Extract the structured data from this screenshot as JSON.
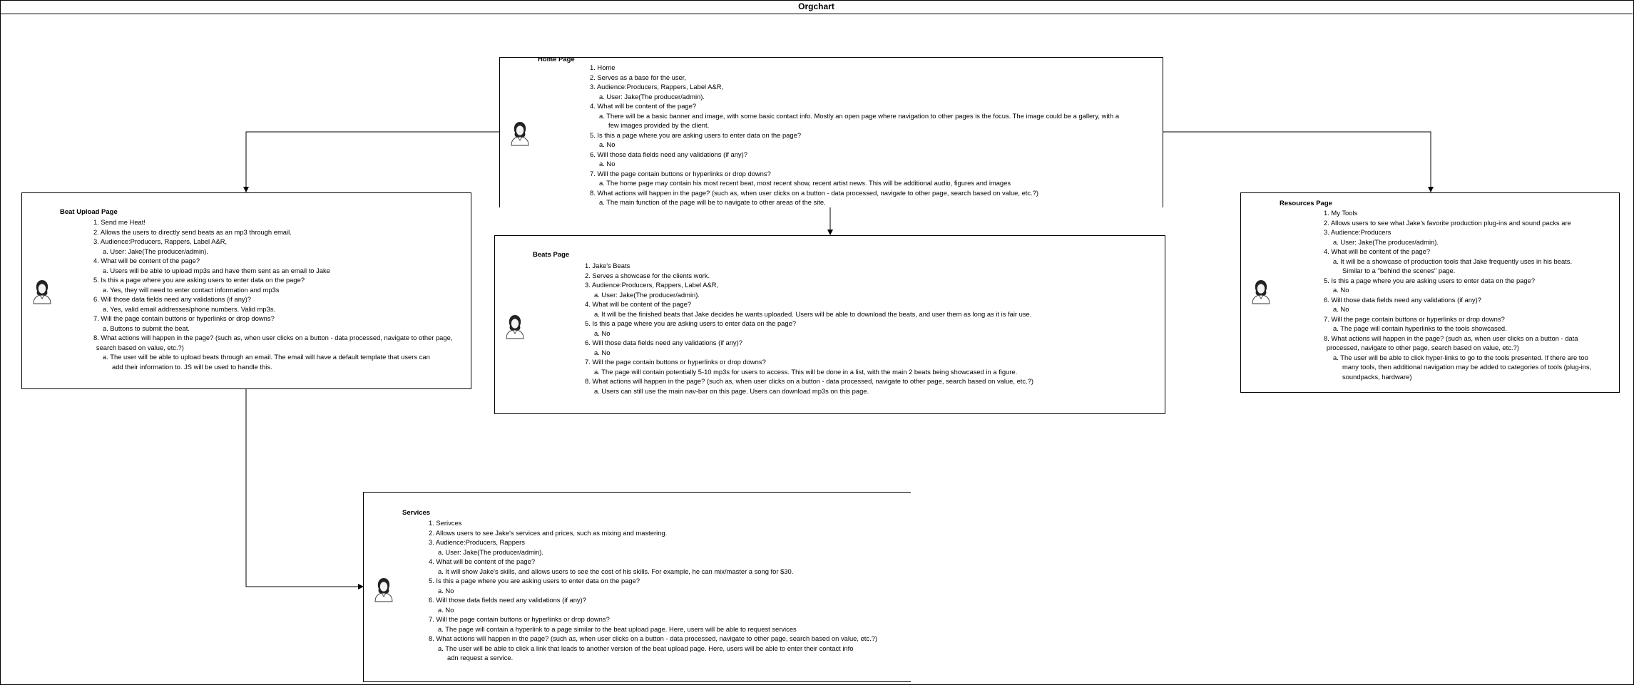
{
  "title": "Orgchart",
  "nodes": [
    {
      "id": "home",
      "title": "Home Page",
      "lines": [
        {
          "t": "1. Home"
        },
        {
          "t": "2. Serves as a base for the user,"
        },
        {
          "t": "3. Audience:Producers, Rappers, Label A&R,"
        },
        {
          "t": "a. User: Jake(The producer/admin).",
          "i": 1
        },
        {
          "t": "4. What will be content of the page?"
        },
        {
          "t": "a.  There will be a basic banner and image, with some basic contact info. Mostly an open page where navigation to other pages is the focus. The image could be a gallery, with a",
          "i": 1
        },
        {
          "t": "few images provided by the client.",
          "i": 2
        },
        {
          "t": "5. Is this a page where you are asking users to enter data on the page?"
        },
        {
          "t": "a. No",
          "i": 1
        },
        {
          "t": "6. Will those data fields need any validations (if any)?"
        },
        {
          "t": "a. No",
          "i": 1
        },
        {
          "t": "7. Will the page contain buttons or hyperlinks or drop downs?"
        },
        {
          "t": "a. The home page may contain his most recent beat, most recent show, recent artist news. This will be additional audio, figures and images",
          "i": 1
        },
        {
          "t": "8. What actions will happen in the page? (such as, when user clicks on a button - data processed, navigate to other page, search based on value, etc.?)"
        },
        {
          "t": "a. The main function of the page will be to navigate to other areas of the site.",
          "i": 1
        }
      ]
    },
    {
      "id": "beat-upload",
      "title": "Beat Upload Page",
      "lines": [
        {
          "t": "1. Send me Heat!"
        },
        {
          "t": "2. Allows the users to directly send beats as an mp3 through email."
        },
        {
          "t": "3. Audience:Producers, Rappers, Label A&R,"
        },
        {
          "t": "a. User: Jake(The producer/admin).",
          "i": 1
        },
        {
          "t": "4. What will be content of the page?"
        },
        {
          "t": "a.  Users will be able to upload mp3s and have them sent as an email to Jake",
          "i": 1
        },
        {
          "t": "5. Is this a page where you are asking users to enter data on the page?"
        },
        {
          "t": "a. Yes, they will need to enter contact information and mp3s",
          "i": 1
        },
        {
          "t": "6. Will those data fields need any validations (if any)?"
        },
        {
          "t": "a. Yes, valid email addresses/phone numbers. Valid mp3s.",
          "i": 1
        },
        {
          "t": "7. Will the page contain buttons or hyperlinks or drop downs?"
        },
        {
          "t": "a. Buttons to submit the beat.",
          "i": 1
        },
        {
          "t": "8. What actions will happen in the page? (such as, when user clicks on a button - data processed, navigate to other page,"
        },
        {
          "t": "search based on value, etc.?)",
          "i": 0.3
        },
        {
          "t": "a. The user will be able to upload beats through an email. The email will have a default template that users can",
          "i": 1
        },
        {
          "t": "add their information to. JS will be used to handle this.",
          "i": 2
        }
      ]
    },
    {
      "id": "beats",
      "title": "Beats Page",
      "lines": [
        {
          "t": "1. Jake's Beats"
        },
        {
          "t": "2. Serves a showcase for the clients work."
        },
        {
          "t": "3. Audience:Producers, Rappers, Label A&R,"
        },
        {
          "t": "a. User: Jake(The producer/admin).",
          "i": 1
        },
        {
          "t": "4. What will be content of the page?"
        },
        {
          "t": "a.  It will be the finished beats that Jake decides he wants uploaded. Users will be able to download the beats, and user them as long as it is fair use.",
          "i": 1
        },
        {
          "t": "5. Is this a page where you are asking users to enter data on the page?"
        },
        {
          "t": "a. No",
          "i": 1
        },
        {
          "t": "6. Will those data fields need any validations (if any)?"
        },
        {
          "t": "a. No",
          "i": 1
        },
        {
          "t": "7. Will the page contain buttons or hyperlinks or drop downs?"
        },
        {
          "t": "a. The page will contain potentially 5-10 mp3s for users to access. This will be done in a list, with the main 2 beats being showcased in a figure.",
          "i": 1
        },
        {
          "t": "8. What actions will happen in the page? (such as, when user clicks on a button - data processed, navigate to other page, search based on value, etc.?)"
        },
        {
          "t": "a. Users can still use the main nav-bar on this page. Users can download mp3s on this page.",
          "i": 1
        }
      ]
    },
    {
      "id": "resources",
      "title": "Resources Page",
      "lines": [
        {
          "t": "1. My Tools"
        },
        {
          "t": "2. Allows users to see what Jake's favorite production plug-ins and sound packs are"
        },
        {
          "t": "3. Audience:Producers"
        },
        {
          "t": "a. User: Jake(The producer/admin).",
          "i": 1
        },
        {
          "t": "4. What will be content of the page?"
        },
        {
          "t": "a.  It will be a showcase of production tools that Jake frequently uses in his beats.",
          "i": 1
        },
        {
          "t": "Similar to a \"behind the scenes\" page.",
          "i": 2
        },
        {
          "t": "5. Is this a page where you are asking users to enter data on the page?"
        },
        {
          "t": "a. No",
          "i": 1
        },
        {
          "t": "6. Will those data fields need any validations (if any)?"
        },
        {
          "t": "a. No",
          "i": 1
        },
        {
          "t": "7. Will the page contain buttons or hyperlinks or drop downs?"
        },
        {
          "t": "a. The page will contain hyperlinks to the tools showcased.",
          "i": 1
        },
        {
          "t": "8. What actions will happen in the page? (such as, when user clicks on a button - data"
        },
        {
          "t": "processed, navigate to other page, search based on value, etc.?)",
          "i": 0.3
        },
        {
          "t": "a. The user will be able to click hyper-links to go to the tools presented. If there are too",
          "i": 1
        },
        {
          "t": "many tools, then additional navigation may be added to categories of tools (plug-ins,",
          "i": 2
        },
        {
          "t": "soundpacks, hardware)",
          "i": 2
        }
      ]
    },
    {
      "id": "services",
      "title": "Services",
      "lines": [
        {
          "t": "1. Serivces"
        },
        {
          "t": "2. Allows users to see Jake's services and prices, such as mixing and mastering."
        },
        {
          "t": "3. Audience:Producers, Rappers"
        },
        {
          "t": "a. User: Jake(The producer/admin).",
          "i": 1
        },
        {
          "t": "4. What will be content of the page?"
        },
        {
          "t": "a.  It will show Jake's skills, and allows users to see the cost of his skills. For example, he can mix/master a song for $30.",
          "i": 1
        },
        {
          "t": "5. Is this a page where you are asking users to enter data on the page?"
        },
        {
          "t": "a. No",
          "i": 1
        },
        {
          "t": "6. Will those data fields need any validations (if any)?"
        },
        {
          "t": "a. No",
          "i": 1
        },
        {
          "t": "7. Will the page contain buttons or hyperlinks or drop downs?"
        },
        {
          "t": "a. The page will contain a hyperlink to a page similar to the beat upload page. Here, users will be able to request services",
          "i": 1
        },
        {
          "t": "8. What actions will happen in the page? (such as, when user clicks on a button - data processed, navigate to other page, search based on value, etc.?)"
        },
        {
          "t": "a. The user will be able to click a link that leads to another version of the beat upload page. Here, users will be able to enter their contact info",
          "i": 1
        },
        {
          "t": "adn request a service.",
          "i": 2
        }
      ]
    }
  ]
}
